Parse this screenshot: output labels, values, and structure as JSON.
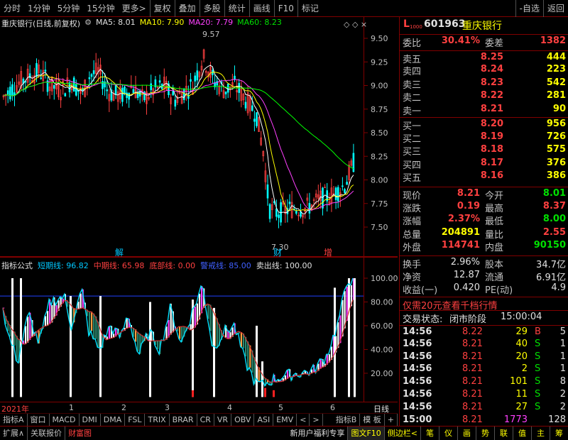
{
  "toolbar": {
    "left": [
      "分时",
      "1分钟",
      "5分钟",
      "15分钟",
      "更多>"
    ],
    "mid": [
      "复权",
      "叠加",
      "多股",
      "统计",
      "画线",
      "F10",
      "标记"
    ],
    "right": [
      "-自选",
      "返回"
    ]
  },
  "main_title": {
    "name": "重庆银行(日线,前复权)",
    "ma5": "MA5: 8.01",
    "ma10": "MA10: 7.90",
    "ma20": "MA20: 7.79",
    "ma60": "MA60: 8.23",
    "high_label": "9.57",
    "low_label": "7.30",
    "marks": [
      "解",
      "财",
      "增"
    ],
    "colors": {
      "ma5": "#ffffff",
      "ma10": "#ffff00",
      "ma20": "#ff40ff",
      "ma60": "#00ff00",
      "up": "#ff4040",
      "down": "#00ffff"
    }
  },
  "price_axis": [
    "9.50",
    "9.25",
    "9.00",
    "8.75",
    "8.50",
    "8.25",
    "8.00",
    "7.75",
    "7.50"
  ],
  "indicator_title": {
    "name": "指标公式",
    "short": "短期线: 96.82",
    "mid": "中期线: 65.98",
    "bottom": "底部线: 0.00",
    "watch": "警戒线: 85.00",
    "sell": "卖出线: 100.00"
  },
  "ind_axis": [
    "100.00",
    "80.00",
    "60.00",
    "40.00",
    "20.00"
  ],
  "time_axis": {
    "year": "2021年",
    "months": [
      "1",
      "2",
      "3",
      "4",
      "5",
      "6"
    ],
    "right": "日线"
  },
  "tabs": [
    "指标A",
    "窗口",
    "MACD",
    "DMI",
    "DMA",
    "FSL",
    "TRIX",
    "BRAR",
    "CR",
    "VR",
    "OBV",
    "ASI",
    "EMV",
    "<",
    ">",
    "指标B",
    "模 板",
    "+"
  ],
  "bottom_bar": {
    "left": [
      "扩展∧",
      "关联报价",
      "财富图"
    ],
    "mid": [
      "新用户福利专享",
      "图文F10",
      "侧边栏<"
    ],
    "right": [
      "笔",
      "仪",
      "画",
      "势",
      "联",
      "值",
      "主",
      "筹"
    ]
  },
  "quote": {
    "code": "601963",
    "name": "重庆银行",
    "weibi_label": "委比",
    "weibi": "30.41%",
    "weicha_label": "委差",
    "weicha": "1382",
    "asks": [
      {
        "label": "卖五",
        "price": "8.25",
        "vol": "444"
      },
      {
        "label": "卖四",
        "price": "8.24",
        "vol": "223"
      },
      {
        "label": "卖三",
        "price": "8.23",
        "vol": "542"
      },
      {
        "label": "卖二",
        "price": "8.22",
        "vol": "281"
      },
      {
        "label": "卖一",
        "price": "8.21",
        "vol": "90"
      }
    ],
    "bids": [
      {
        "label": "买一",
        "price": "8.20",
        "vol": "956"
      },
      {
        "label": "买二",
        "price": "8.19",
        "vol": "726"
      },
      {
        "label": "买三",
        "price": "8.18",
        "vol": "575"
      },
      {
        "label": "买四",
        "price": "8.17",
        "vol": "376"
      },
      {
        "label": "买五",
        "price": "8.16",
        "vol": "386"
      }
    ],
    "stats": [
      {
        "l1": "现价",
        "v1": "8.21",
        "c1": "red",
        "l2": "今开",
        "v2": "8.01",
        "c2": "green"
      },
      {
        "l1": "涨跌",
        "v1": "0.19",
        "c1": "red",
        "l2": "最高",
        "v2": "8.37",
        "c2": "red"
      },
      {
        "l1": "涨幅",
        "v1": "2.37%",
        "c1": "red",
        "l2": "最低",
        "v2": "8.00",
        "c2": "green"
      },
      {
        "l1": "总量",
        "v1": "204891",
        "c1": "yellow",
        "l2": "量比",
        "v2": "2.55",
        "c2": "red"
      },
      {
        "l1": "外盘",
        "v1": "114741",
        "c1": "red",
        "l2": "内盘",
        "v2": "90150",
        "c2": "green"
      }
    ],
    "stats2": [
      {
        "l1": "换手",
        "v1": "2.96%",
        "l2": "股本",
        "v2": "34.7亿"
      },
      {
        "l1": "净资",
        "v1": "12.87",
        "l2": "流通",
        "v2": "6.91亿"
      },
      {
        "l1": "收益(一)",
        "v1": "0.420",
        "l2": "PE(动)",
        "v2": "4.9"
      }
    ],
    "promo": "仅需20元查看千档行情",
    "status_label": "交易状态:",
    "status": "闭市阶段",
    "status_time": "15:00:04",
    "ticks": [
      {
        "t": "14:56",
        "p": "8.22",
        "v": "29",
        "d": "B",
        "n": "5"
      },
      {
        "t": "14:56",
        "p": "8.21",
        "v": "40",
        "d": "S",
        "n": "1"
      },
      {
        "t": "14:56",
        "p": "8.21",
        "v": "20",
        "d": "S",
        "n": "1"
      },
      {
        "t": "14:56",
        "p": "8.21",
        "v": "2",
        "d": "S",
        "n": "1"
      },
      {
        "t": "14:56",
        "p": "8.21",
        "v": "101",
        "d": "S",
        "n": "8"
      },
      {
        "t": "14:56",
        "p": "8.21",
        "v": "11",
        "d": "S",
        "n": "2"
      },
      {
        "t": "14:56",
        "p": "8.21",
        "v": "27",
        "d": "S",
        "n": "2"
      },
      {
        "t": "15:00",
        "p": "8.21",
        "v": "1773",
        "d": "",
        "n": "128"
      }
    ]
  }
}
